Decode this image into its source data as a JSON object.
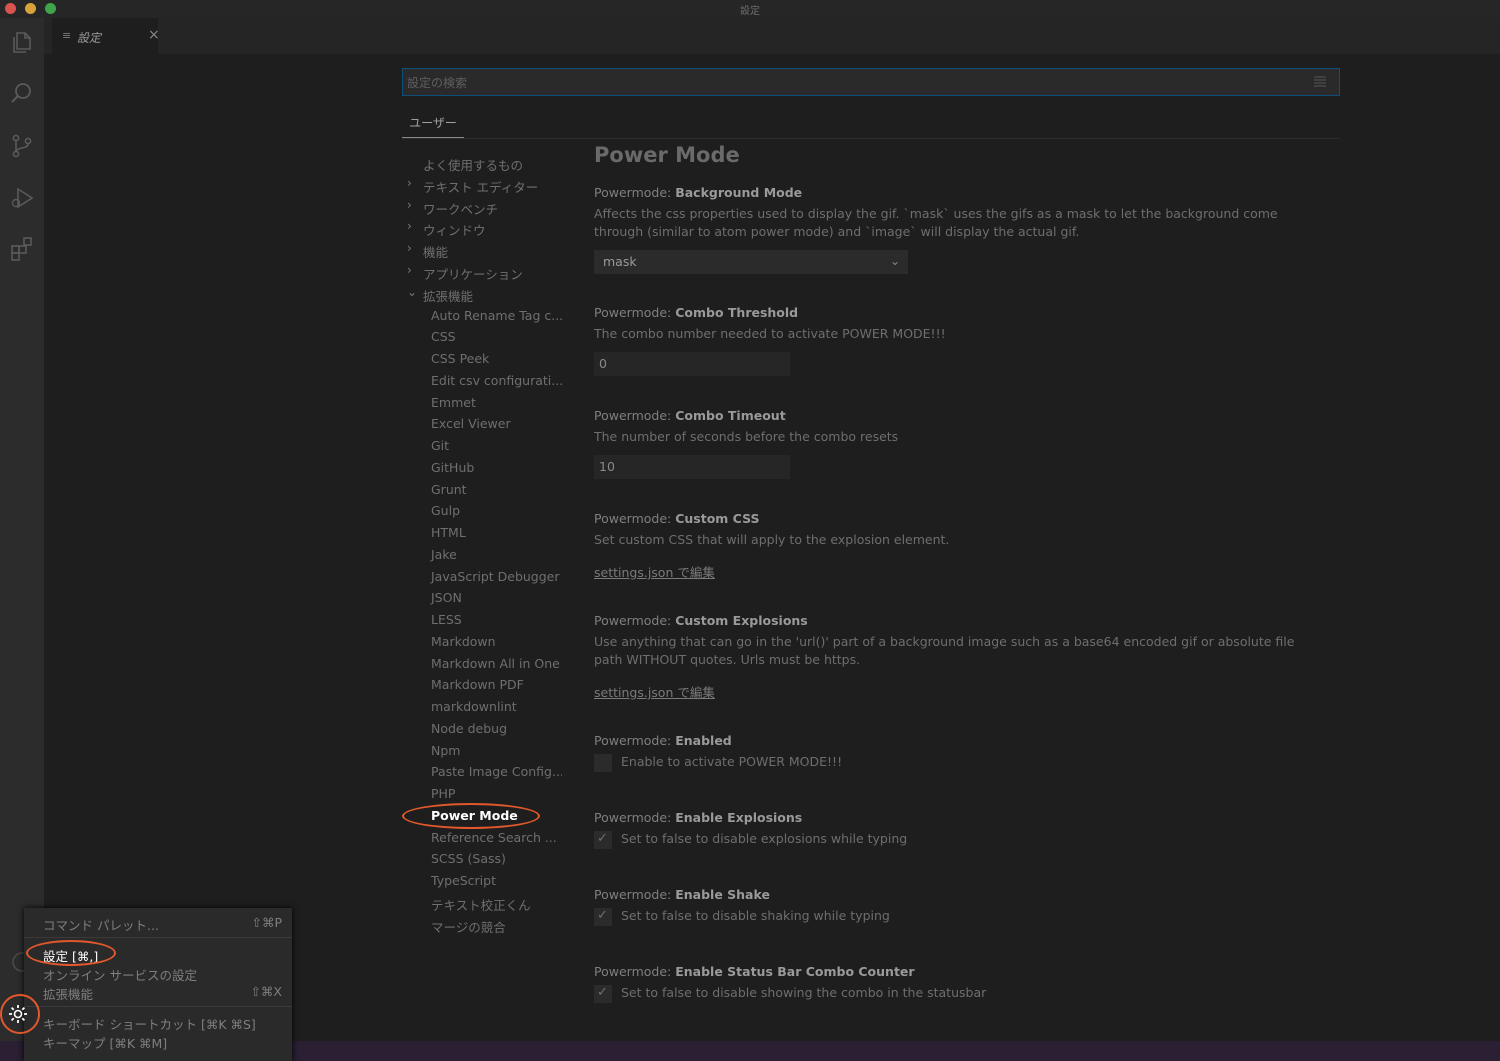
{
  "window": {
    "title": "設定"
  },
  "colors": {
    "accent_highlight": "#e0582b",
    "focus_border": "#0e4f79",
    "background": "#1e1e1e"
  },
  "activity_bar": {
    "icons": [
      "files-icon",
      "search-icon",
      "source-control-icon",
      "run-debug-icon",
      "extensions-icon",
      "account-icon",
      "manage-gear-icon"
    ]
  },
  "tab": {
    "label": "設定",
    "close": "×"
  },
  "search": {
    "placeholder": "設定の検索"
  },
  "scope_tab": {
    "label": "ユーザー"
  },
  "toc": {
    "top": [
      {
        "label": "よく使用するもの",
        "chevron": ""
      },
      {
        "label": "テキスト エディター",
        "chevron": "›"
      },
      {
        "label": "ワークベンチ",
        "chevron": "›"
      },
      {
        "label": "ウィンドウ",
        "chevron": "›"
      },
      {
        "label": "機能",
        "chevron": "›"
      },
      {
        "label": "アプリケーション",
        "chevron": "›"
      },
      {
        "label": "拡張機能",
        "chevron": "⌄"
      }
    ],
    "extensions": [
      "Auto Rename Tag c...",
      "CSS",
      "CSS Peek",
      "Edit csv configurati...",
      "Emmet",
      "Excel Viewer",
      "Git",
      "GitHub",
      "Grunt",
      "Gulp",
      "HTML",
      "Jake",
      "JavaScript Debugger",
      "JSON",
      "LESS",
      "Markdown",
      "Markdown All in One",
      "Markdown PDF",
      "markdownlint",
      "Node debug",
      "Npm",
      "Paste Image Config...",
      "PHP",
      "Power Mode",
      "Reference Search ...",
      "SCSS (Sass)",
      "TypeScript",
      "テキスト校正くん",
      "マージの競合"
    ],
    "active": "Power Mode"
  },
  "content": {
    "section_title": "Power Mode",
    "prefix": "Powermode: ",
    "background_mode": {
      "title": "Background Mode",
      "desc": "Affects the css properties used to display the gif. `mask` uses the gifs as a mask to let the background come through (similar to atom power mode) and `image` will display the actual gif.",
      "value": "mask"
    },
    "combo_threshold": {
      "title": "Combo Threshold",
      "desc": "The combo number needed to activate POWER MODE!!!",
      "value": "0"
    },
    "combo_timeout": {
      "title": "Combo Timeout",
      "desc": "The number of seconds before the combo resets",
      "value": "10"
    },
    "custom_css": {
      "title": "Custom CSS",
      "desc": "Set custom CSS that will apply to the explosion element.",
      "link": "settings.json で編集"
    },
    "custom_explosions": {
      "title": "Custom Explosions",
      "desc": "Use anything that can go in the 'url()' part of a background image such as a base64 encoded gif or absolute file path WITHOUT quotes. Urls must be https.",
      "link": "settings.json で編集"
    },
    "enabled": {
      "title": "Enabled",
      "label": "Enable to activate POWER MODE!!!",
      "checked": false
    },
    "enable_explosions": {
      "title": "Enable Explosions",
      "label": "Set to false to disable explosions while typing",
      "checked": true
    },
    "enable_shake": {
      "title": "Enable Shake",
      "label": "Set to false to disable shaking while typing",
      "checked": true
    },
    "enable_status_bar": {
      "title": "Enable Status Bar Combo Counter",
      "label": "Set to false to disable showing the combo in the statusbar",
      "checked": true
    }
  },
  "menu": {
    "command_palette": {
      "label": "コマンド パレット...",
      "key": "⇧⌘P"
    },
    "settings": {
      "label": "設定 [⌘,]"
    },
    "online_services": {
      "label": "オンライン サービスの設定"
    },
    "extensions": {
      "label": "拡張機能",
      "key": "⇧⌘X"
    },
    "keyboard_shortcuts": {
      "label": "キーボード ショートカット [⌘K ⌘S]"
    },
    "keymap": {
      "label": "キーマップ [⌘K ⌘M]"
    }
  },
  "checkmark": "✓"
}
